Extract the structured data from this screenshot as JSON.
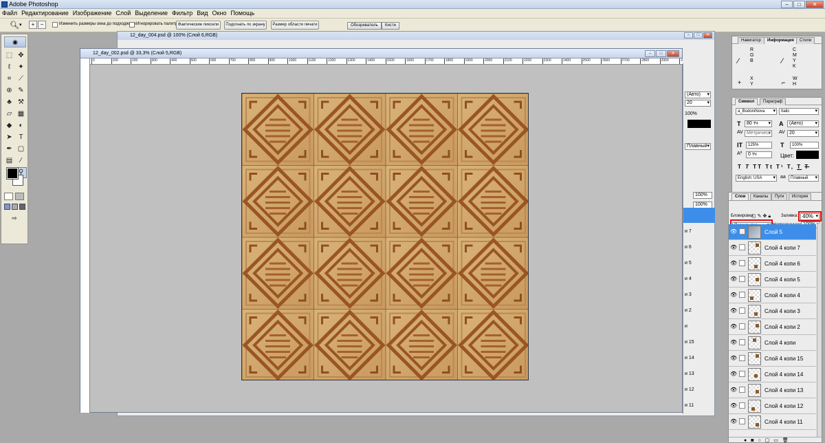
{
  "app": {
    "title": "Adobe Photoshop"
  },
  "menu": [
    "Файл",
    "Редактирование",
    "Изображение",
    "Слой",
    "Выделение",
    "Фильтр",
    "Вид",
    "Окно",
    "Помощь"
  ],
  "options": {
    "resize_label": "Изменить размеры окна до подходящих",
    "ignore_label": "Игнорировать палитру",
    "actual_pixels": "Фактические пиксели",
    "fit_screen": "Подогнать по экрану",
    "print_size": "Размер области печати",
    "tab_browser": "Обозреватель",
    "tab_brushes": "Кисти"
  },
  "doc_back": {
    "title": "12_day_004.psd @ 100% (Слой 6,RGB)"
  },
  "doc_main": {
    "title": "12_day_002.psd @ 33,3% (Слой 5,RGB)",
    "ruler": [
      "0",
      "100",
      "200",
      "300",
      "400",
      "500",
      "600",
      "700",
      "800",
      "900",
      "1000",
      "1100",
      "1200",
      "1300",
      "1400",
      "1500",
      "1600",
      "1700",
      "1800",
      "1900",
      "2000",
      "2100",
      "2200",
      "2300",
      "2400",
      "2500",
      "2600",
      "2700",
      "2800",
      "2900",
      "3000"
    ]
  },
  "midpanel": {
    "rows": [
      "(Авто)",
      "20",
      "100%",
      "Плавный",
      "100%",
      "100%",
      "и 7",
      "и 6",
      "и 5",
      "и 4",
      "и 3",
      "и 2",
      "и",
      "и 15",
      "и 14",
      "и 13",
      "и 12",
      "и 11"
    ]
  },
  "info_panel": {
    "tabs": [
      "Навигатор",
      "Информация",
      "Стили"
    ],
    "r": "R",
    "g": "G",
    "b": "B",
    "c": "C",
    "m": "M",
    "yy": "Y",
    "k": "K",
    "x": "X",
    "y": "Y",
    "w": "W",
    "h": "H"
  },
  "char_panel": {
    "tabs": [
      "Символ",
      "Параграф"
    ],
    "font": "a_BodoniNova",
    "style": "Italic",
    "size": "80 тч",
    "leading": "(Авто)",
    "kerning": "Метрическ",
    "tracking": "20",
    "scale_v": "125%",
    "scale_h": "100%",
    "baseline": "0 тч",
    "color_label": "Цвет:",
    "language": "English: USA",
    "aa": "Плавный",
    "tt_buttons": [
      "T",
      "T",
      "TT",
      "Tt",
      "T¹",
      "T,",
      "T",
      "Ŧ"
    ]
  },
  "layers_panel": {
    "tabs": [
      "Слои",
      "Каналы",
      "Пути",
      "История"
    ],
    "blend_mode": "Перекрытие",
    "opacity_label": "Непрозрачность:",
    "opacity": "100%",
    "lock_label": "Блокировка:",
    "fill_label": "Заливка:",
    "fill": "40%",
    "layers": [
      "Слой 5",
      "Слой 4 копи 7",
      "Слой 4 копи 6",
      "Слой 4 копи 5",
      "Слой 4 копи 4",
      "Слой 4 копи 3",
      "Слой 4 копи 2",
      "Слой 4 копи",
      "Слой 4 копи 15",
      "Слой 4 копи 14",
      "Слой 4 копи 13",
      "Слой 4 копи 12",
      "Слой 4 копи 11"
    ]
  },
  "colors": {
    "highlight": "#e01010",
    "selection": "#3d8ee8"
  }
}
